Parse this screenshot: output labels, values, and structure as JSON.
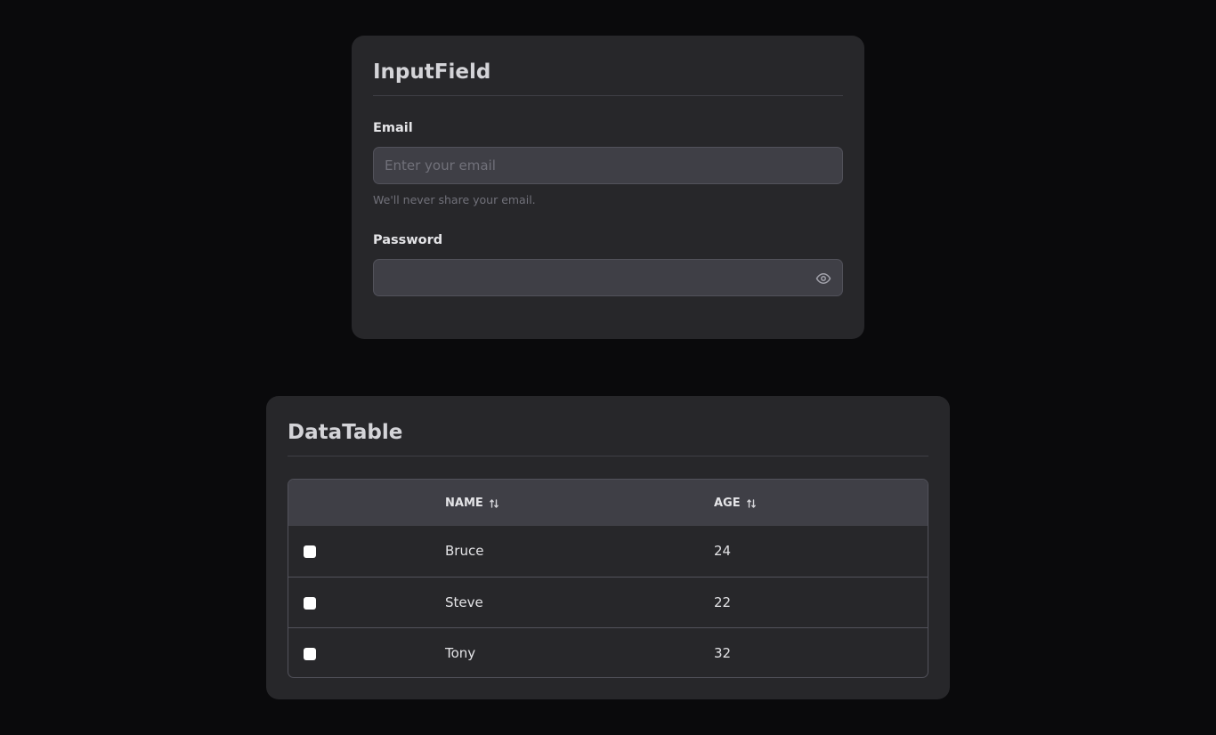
{
  "input_card": {
    "title": "InputField",
    "email": {
      "label": "Email",
      "placeholder": "Enter your email",
      "value": "",
      "helper": "We'll never share your email."
    },
    "password": {
      "label": "Password",
      "value": "",
      "toggle_icon": "eye-icon"
    }
  },
  "table_card": {
    "title": "DataTable",
    "columns": [
      {
        "label": "NAME",
        "sort_icon": "sort-icon"
      },
      {
        "label": "AGE",
        "sort_icon": "sort-icon"
      }
    ],
    "rows": [
      {
        "name": "Bruce",
        "age": "24",
        "checked": false
      },
      {
        "name": "Steve",
        "age": "22",
        "checked": false
      },
      {
        "name": "Tony",
        "age": "32",
        "checked": false
      }
    ]
  },
  "colors": {
    "background": "#0a0a0c",
    "card": "#27272a",
    "input": "#3f3f46",
    "border": "#52525b"
  }
}
